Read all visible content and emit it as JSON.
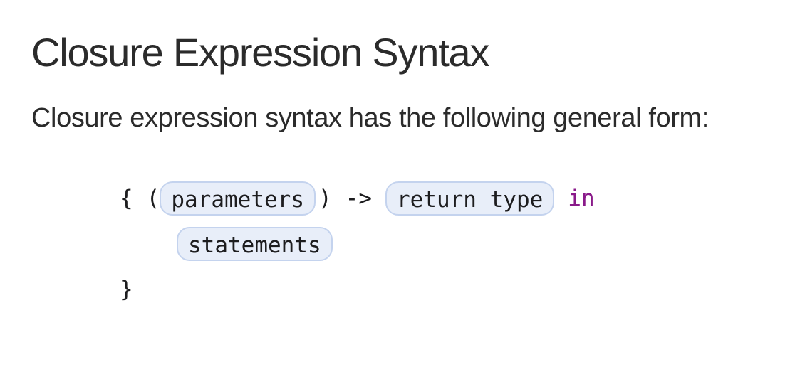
{
  "page": {
    "title": "Closure Expression Syntax",
    "intro": "Closure expression syntax has the following general form:"
  },
  "code": {
    "open_brace": "{",
    "open_paren": "(",
    "parameters": "parameters",
    "close_paren": ")",
    "arrow": "->",
    "return_type": "return type",
    "keyword_in": "in",
    "statements": "statements",
    "close_brace": "}"
  },
  "colors": {
    "keyword": "#8a1a8a",
    "placeholder_bg": "#e8eef9",
    "placeholder_border": "#c4d3ee",
    "text": "#2b2b2b"
  }
}
